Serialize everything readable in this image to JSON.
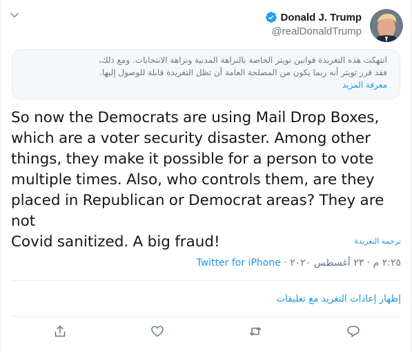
{
  "author": {
    "display_name": "Donald J. Trump",
    "handle": "@realDonaldTrump",
    "verified": true
  },
  "notice": {
    "line1": "انتهكت هذه التغريدة قوانين تويتر الخاصة بالنزاهة المدنية ونزاهة الانتخابات. ومع ذلك،",
    "line2": "فقد قرر تويتر أنه ربما يكون من المصلحة العامة أن تظل التغريدة قابلة للوصول إليها.",
    "link": "معرفة المزيد"
  },
  "tweet": {
    "lines": [
      "So now the Democrats are using Mail Drop Boxes,",
      "which are a voter security disaster. Among other",
      "things, they make it possible for a person to vote",
      "multiple times. Also, who controls them, are they",
      "placed in Republican or Democrat areas? They are not",
      "Covid sanitized. A big fraud!"
    ],
    "translate_label": "ترجمة التغريدة",
    "timestamp": "٢:٢٥ م · ٢٣ أغسطس ٢٠٢٠",
    "separator": " · ",
    "source": "Twitter for iPhone"
  },
  "retweets_with_comments": "إظهار إعادات التغريد مع تعليقات",
  "actions": {
    "reply_icon": "reply-icon",
    "retweet_icon": "retweet-icon",
    "like_icon": "heart-icon",
    "share_icon": "share-icon"
  },
  "colors": {
    "accent": "#1b95e0",
    "verified": "#1da1f2",
    "text": "#14171a",
    "secondary": "#657786",
    "notice_bg": "#f5f8fa"
  }
}
